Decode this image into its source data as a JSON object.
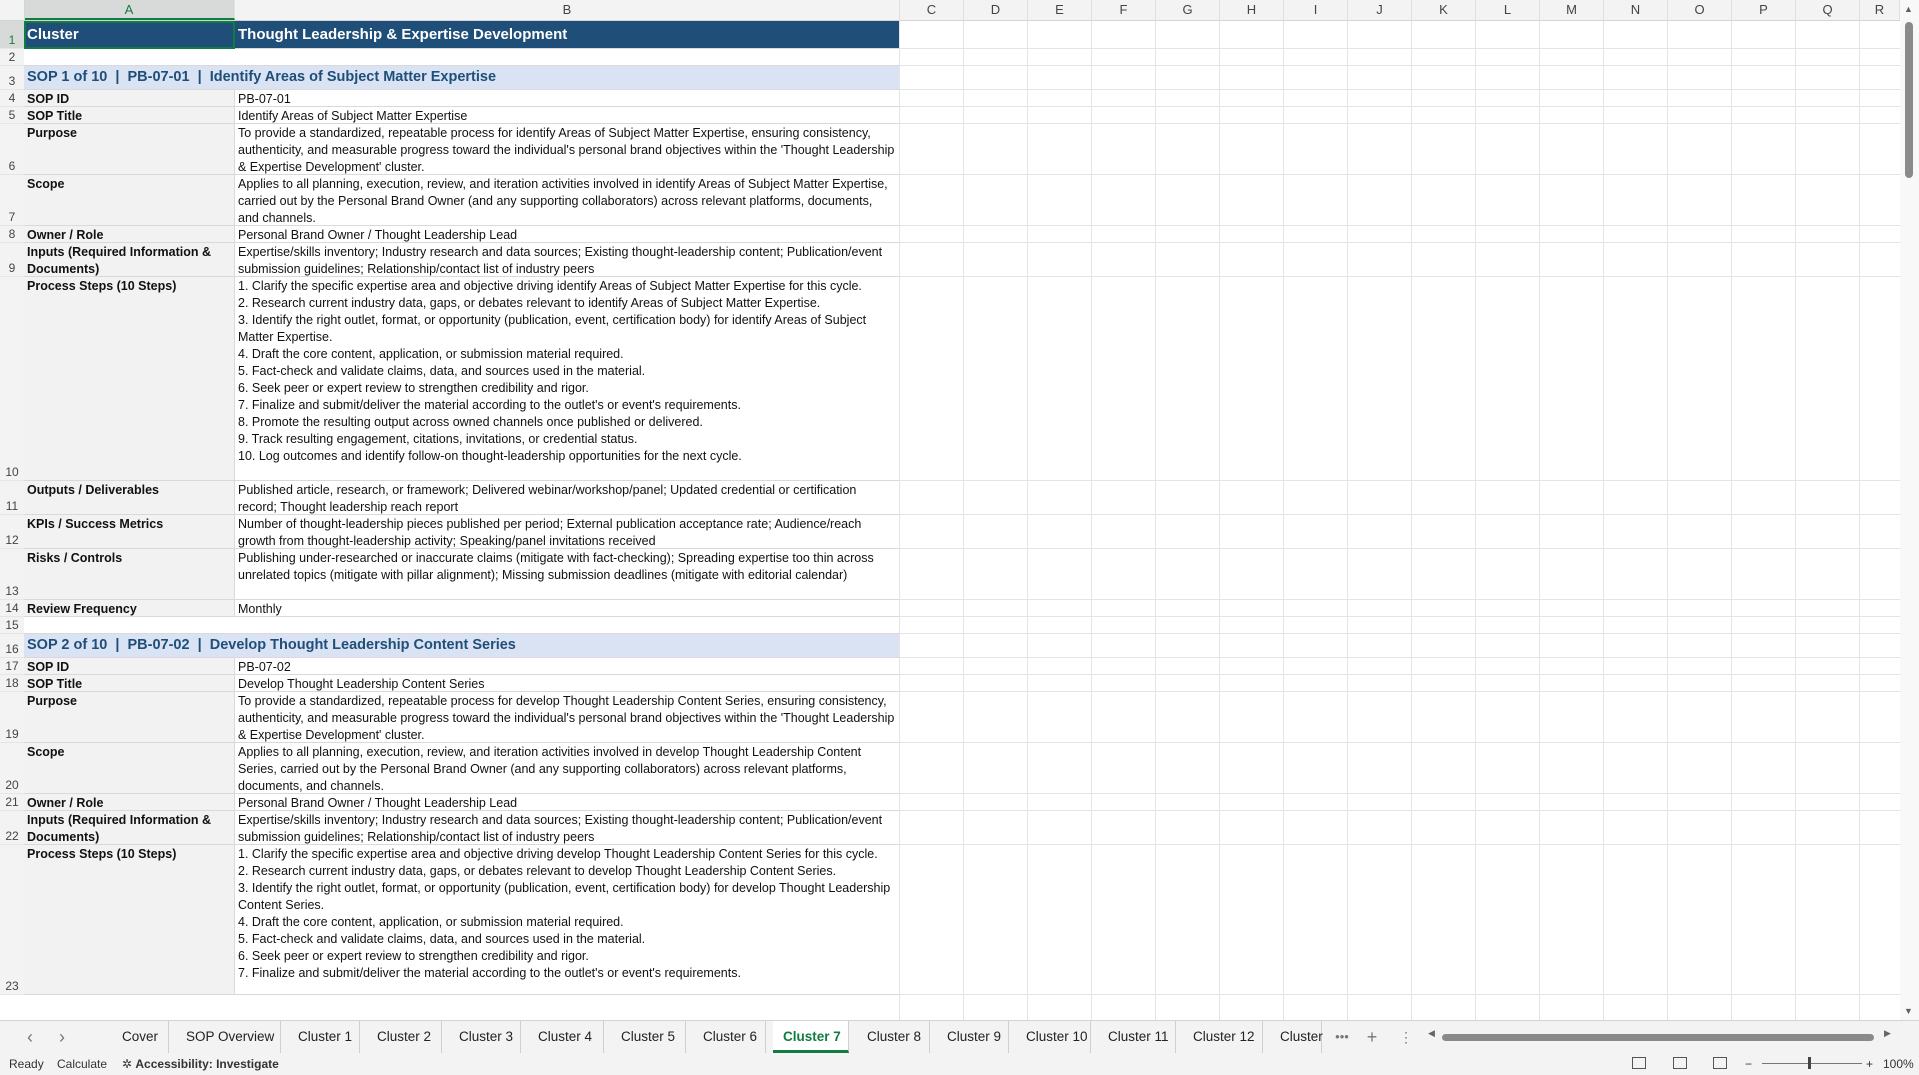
{
  "columns": [
    "A",
    "B",
    "C",
    "D",
    "E",
    "F",
    "G",
    "H",
    "I",
    "J",
    "K",
    "L",
    "M",
    "N",
    "O",
    "P",
    "Q",
    "R"
  ],
  "rows": [
    {
      "n": "1",
      "type": "title",
      "a": "Cluster",
      "b": "Thought Leadership & Expertise Development"
    },
    {
      "n": "2",
      "type": "blank",
      "a": "",
      "b": ""
    },
    {
      "n": "3",
      "type": "sop",
      "a": "SOP 1 of 10  |  PB-07-01  |  Identify Areas of Subject Matter Expertise",
      "b": ""
    },
    {
      "n": "4",
      "type": "field",
      "a": "SOP ID",
      "b": "PB-07-01"
    },
    {
      "n": "5",
      "type": "field",
      "a": "SOP Title",
      "b": "Identify Areas of Subject Matter Expertise"
    },
    {
      "n": "6",
      "type": "field",
      "a": "Purpose",
      "b": "To provide a standardized, repeatable process for identify Areas of Subject Matter Expertise, ensuring consistency, authenticity, and measurable progress toward the individual's personal brand objectives within the 'Thought Leadership & Expertise Development' cluster."
    },
    {
      "n": "7",
      "type": "field",
      "a": "Scope",
      "b": "Applies to all planning, execution, review, and iteration activities involved in identify Areas of Subject Matter Expertise, carried out by the Personal Brand Owner (and any supporting collaborators) across relevant platforms, documents, and channels."
    },
    {
      "n": "8",
      "type": "field",
      "a": "Owner / Role",
      "b": "Personal Brand Owner / Thought Leadership Lead"
    },
    {
      "n": "9",
      "type": "field",
      "a": "Inputs (Required Information & Documents)",
      "b": "Expertise/skills inventory; Industry research and data sources; Existing thought-leadership content; Publication/event submission guidelines; Relationship/contact list of industry peers"
    },
    {
      "n": "10",
      "type": "field",
      "a": "Process Steps (10 Steps)",
      "b": "1. Clarify the specific expertise area and objective driving identify Areas of Subject Matter Expertise for this cycle.\n2. Research current industry data, gaps, or debates relevant to identify Areas of Subject Matter Expertise.\n3. Identify the right outlet, format, or opportunity (publication, event, certification body) for identify Areas of Subject Matter Expertise.\n4. Draft the core content, application, or submission material required.\n5. Fact-check and validate claims, data, and sources used in the material.\n6. Seek peer or expert review to strengthen credibility and rigor.\n7. Finalize and submit/deliver the material according to the outlet's or event's requirements.\n8. Promote the resulting output across owned channels once published or delivered.\n9. Track resulting engagement, citations, invitations, or credential status.\n10. Log outcomes and identify follow-on thought-leadership opportunities for the next cycle."
    },
    {
      "n": "11",
      "type": "field",
      "a": "Outputs / Deliverables",
      "b": "Published article, research, or framework; Delivered webinar/workshop/panel; Updated credential or certification record; Thought leadership reach report"
    },
    {
      "n": "12",
      "type": "field",
      "a": "KPIs / Success Metrics",
      "b": "Number of thought-leadership pieces published per period; External publication acceptance rate; Audience/reach growth from thought-leadership activity; Speaking/panel invitations received"
    },
    {
      "n": "13",
      "type": "field",
      "a": "Risks / Controls",
      "b": "Publishing under-researched or inaccurate claims (mitigate with fact-checking); Spreading expertise too thin across unrelated topics (mitigate with pillar alignment); Missing submission deadlines (mitigate with editorial calendar)"
    },
    {
      "n": "14",
      "type": "field",
      "a": "Review Frequency",
      "b": "Monthly"
    },
    {
      "n": "15",
      "type": "blank",
      "a": "",
      "b": ""
    },
    {
      "n": "16",
      "type": "sop",
      "a": "SOP 2 of 10  |  PB-07-02  |  Develop Thought Leadership Content Series",
      "b": ""
    },
    {
      "n": "17",
      "type": "field",
      "a": "SOP ID",
      "b": "PB-07-02"
    },
    {
      "n": "18",
      "type": "field",
      "a": "SOP Title",
      "b": "Develop Thought Leadership Content Series"
    },
    {
      "n": "19",
      "type": "field",
      "a": "Purpose",
      "b": "To provide a standardized, repeatable process for develop Thought Leadership Content Series, ensuring consistency, authenticity, and measurable progress toward the individual's personal brand objectives within the 'Thought Leadership & Expertise Development' cluster."
    },
    {
      "n": "20",
      "type": "field",
      "a": "Scope",
      "b": "Applies to all planning, execution, review, and iteration activities involved in develop Thought Leadership Content Series, carried out by the Personal Brand Owner (and any supporting collaborators) across relevant platforms, documents, and channels."
    },
    {
      "n": "21",
      "type": "field",
      "a": "Owner / Role",
      "b": "Personal Brand Owner / Thought Leadership Lead"
    },
    {
      "n": "22",
      "type": "field",
      "a": "Inputs (Required Information & Documents)",
      "b": "Expertise/skills inventory; Industry research and data sources; Existing thought-leadership content; Publication/event submission guidelines; Relationship/contact list of industry peers"
    },
    {
      "n": "23",
      "type": "field",
      "a": "Process Steps (10 Steps)",
      "b": "1. Clarify the specific expertise area and objective driving develop Thought Leadership Content Series for this cycle.\n2. Research current industry data, gaps, or debates relevant to develop Thought Leadership Content Series.\n3. Identify the right outlet, format, or opportunity (publication, event, certification body) for develop Thought Leadership Content Series.\n4. Draft the core content, application, or submission material required.\n5. Fact-check and validate claims, data, and sources used in the material.\n6. Seek peer or expert review to strengthen credibility and rigor.\n7. Finalize and submit/deliver the material according to the outlet's or event's requirements."
    }
  ],
  "tabs": [
    "Cover",
    "SOP Overview",
    "Cluster 1",
    "Cluster 2",
    "Cluster 3",
    "Cluster 4",
    "Cluster 5",
    "Cluster 6",
    "Cluster 7",
    "Cluster 8",
    "Cluster 9",
    "Cluster 10",
    "Cluster 11",
    "Cluster 12",
    "Cluster"
  ],
  "active_tab": "Cluster 7",
  "tab_more": "•••",
  "add_sheet": "+",
  "status": {
    "ready": "Ready",
    "calculate": "Calculate",
    "accessibility": "Accessibility: Investigate",
    "zoom": "100%",
    "zoom_minus": "−",
    "zoom_plus": "+"
  },
  "colors": {
    "header_fill": "#1f4e79",
    "sop_fill": "#dae3f3",
    "accent": "#107c41"
  }
}
